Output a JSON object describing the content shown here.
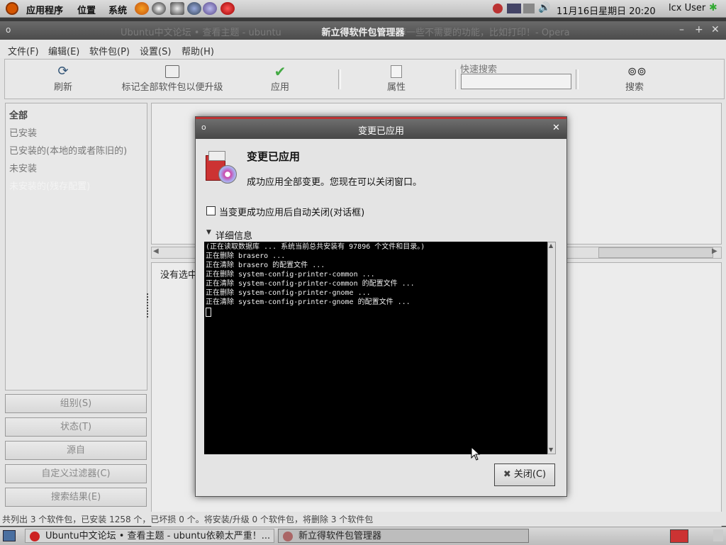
{
  "top_panel": {
    "menus": [
      "应用程序",
      "位置",
      "系统"
    ],
    "clock": "11月16日星期日 20:20",
    "user": "lcx User"
  },
  "window": {
    "title": "新立得软件包管理器",
    "ghost_title_left": "Ubuntu中文论坛 • 查看主题 - ubuntu",
    "ghost_title_right": "掉一些不需要的功能，比如打印！- Opera"
  },
  "menubar": [
    "文件(F)",
    "编辑(E)",
    "软件包(P)",
    "设置(S)",
    "帮助(H)"
  ],
  "toolbar": {
    "refresh": "刷新",
    "mark_upgrades": "标记全部软件包以便升级",
    "apply": "应用",
    "properties": "属性",
    "quick_search_label": "快速搜索",
    "quick_search_value": "",
    "search": "搜索"
  },
  "filters": [
    "全部",
    "已安装",
    "已安装的(本地的或者陈旧的)",
    "未安装",
    "未安装的(残存配置)"
  ],
  "side_buttons": [
    "组别(S)",
    "状态(T)",
    "源自",
    "自定义过滤器(C)",
    "搜索结果(E)"
  ],
  "description_placeholder": "没有选中",
  "status_text": "共列出 3 个软件包，已安装 1258 个，已坏损 0 个。将安装/升级 0 个软件包，将删除 3 个软件包",
  "taskbar": {
    "tasks": [
      "Ubuntu中文论坛 • 查看主题 - ubuntu依赖太严重！...",
      "新立得软件包管理器"
    ]
  },
  "dialog": {
    "title": "变更已应用",
    "heading": "变更已应用",
    "message": "成功应用全部变更。您现在可以关闭窗口。",
    "auto_close_label": "当变更成功应用后自动关闭(对话框)",
    "auto_close_checked": false,
    "details_label": "详细信息",
    "terminal_lines": [
      "(正在读取数据库 ... 系统当前总共安装有 97896 个文件和目录。)",
      "正在删除 brasero ...",
      "正在清除 brasero 的配置文件 ...",
      "正在删除 system-config-printer-common ...",
      "正在清除 system-config-printer-common 的配置文件 ...",
      "正在删除 system-config-printer-gnome ...",
      "正在清除 system-config-printer-gnome 的配置文件 ..."
    ],
    "close_button": "关闭(C)"
  },
  "colors": {
    "dialog_accent": "#b33333",
    "terminal_bg": "#000000",
    "terminal_fg": "#eeeeee"
  }
}
